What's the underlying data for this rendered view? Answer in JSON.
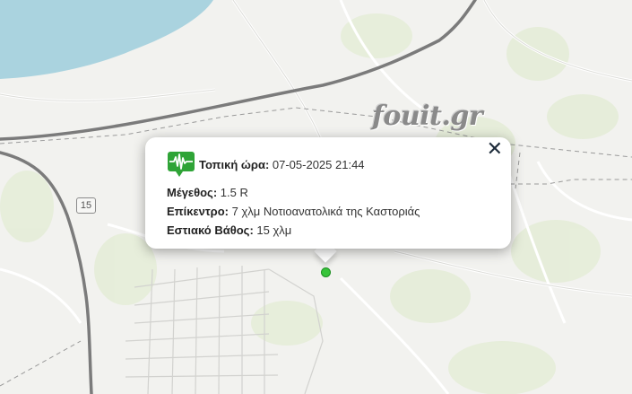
{
  "map": {
    "watermark": "fouit.gr",
    "road_shield": "15",
    "water_color": "#aad3df",
    "marker_color": "#37c43a"
  },
  "popup": {
    "icon": "seismograph-icon",
    "local_time_label": "Τοπική ώρα:",
    "local_time_value": " 07-05-2025 21:44",
    "magnitude_label": "Μέγεθος:",
    "magnitude_value": " 1.5 R",
    "epicenter_label": "Επίκεντρο:",
    "epicenter_value": " 7 χλμ Νοτιοανατολικά της Καστοριάς",
    "depth_label": "Εστιακό Βάθος:",
    "depth_value": " 15 χλμ",
    "close_symbol": "✕"
  }
}
